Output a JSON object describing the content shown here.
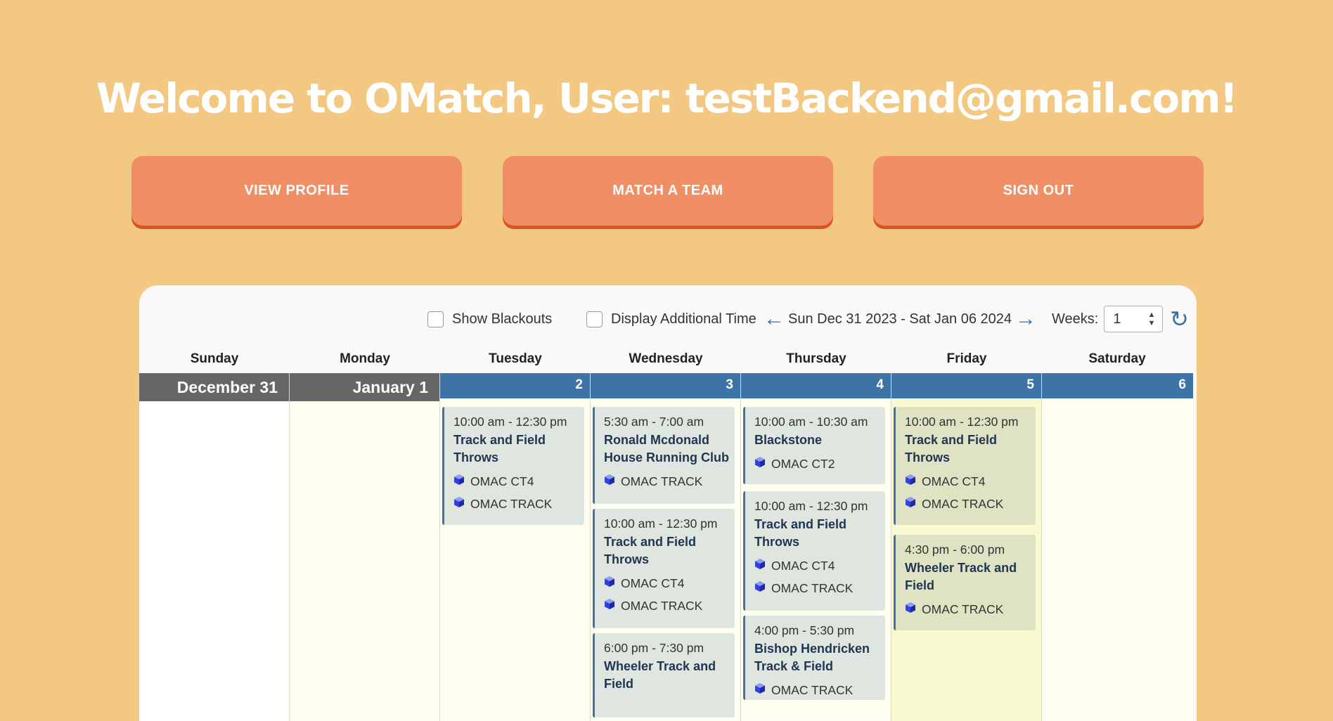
{
  "welcome": "Welcome to OMatch, User: testBackend@gmail.com!",
  "buttons": {
    "view_profile": "VIEW PROFILE",
    "match_team": "MATCH A TEAM",
    "sign_out": "SIGN OUT"
  },
  "toolbar": {
    "show_blackouts": "Show Blackouts",
    "display_additional": "Display Additional Time",
    "date_range": "Sun Dec 31 2023 - Sat Jan 06 2024",
    "weeks_label": "Weeks:",
    "weeks_value": "1"
  },
  "day_names": [
    "Sunday",
    "Monday",
    "Tuesday",
    "Wednesday",
    "Thursday",
    "Friday",
    "Saturday"
  ],
  "day_headers": [
    "December 31",
    "January 1",
    "2",
    "3",
    "4",
    "5",
    "6"
  ],
  "events": {
    "tuesday": [
      {
        "time": "10:00 am - 12:30 pm",
        "title": "Track and Field Throws",
        "locations": [
          "OMAC CT4",
          "OMAC TRACK"
        ]
      }
    ],
    "wednesday": [
      {
        "time": "5:30 am - 7:00 am",
        "title": "Ronald Mcdonald House Running Club",
        "locations": [
          "OMAC TRACK"
        ]
      },
      {
        "time": "10:00 am - 12:30 pm",
        "title": "Track and Field Throws",
        "locations": [
          "OMAC CT4",
          "OMAC TRACK"
        ]
      },
      {
        "time": "6:00 pm - 7:30 pm",
        "title": "Wheeler Track and Field",
        "locations": []
      }
    ],
    "thursday": [
      {
        "time": "10:00 am - 10:30 am",
        "title": "Blackstone",
        "locations": [
          "OMAC CT2"
        ]
      },
      {
        "time": "10:00 am - 12:30 pm",
        "title": "Track and Field Throws",
        "locations": [
          "OMAC CT4",
          "OMAC TRACK"
        ]
      },
      {
        "time": "4:00 pm - 5:30 pm",
        "title": "Bishop Hendricken Track & Field",
        "locations": [
          "OMAC TRACK"
        ]
      }
    ],
    "friday": [
      {
        "time": "10:00 am - 12:30 pm",
        "title": "Track and Field Throws",
        "locations": [
          "OMAC CT4",
          "OMAC TRACK"
        ]
      },
      {
        "time": "4:30 pm - 6:00 pm",
        "title": "Wheeler Track and Field",
        "locations": [
          "OMAC TRACK"
        ]
      }
    ]
  },
  "colors": {
    "background": "#f2c883",
    "button": "#f08f66",
    "header_blue": "#3d73a6",
    "header_past": "#666666"
  }
}
